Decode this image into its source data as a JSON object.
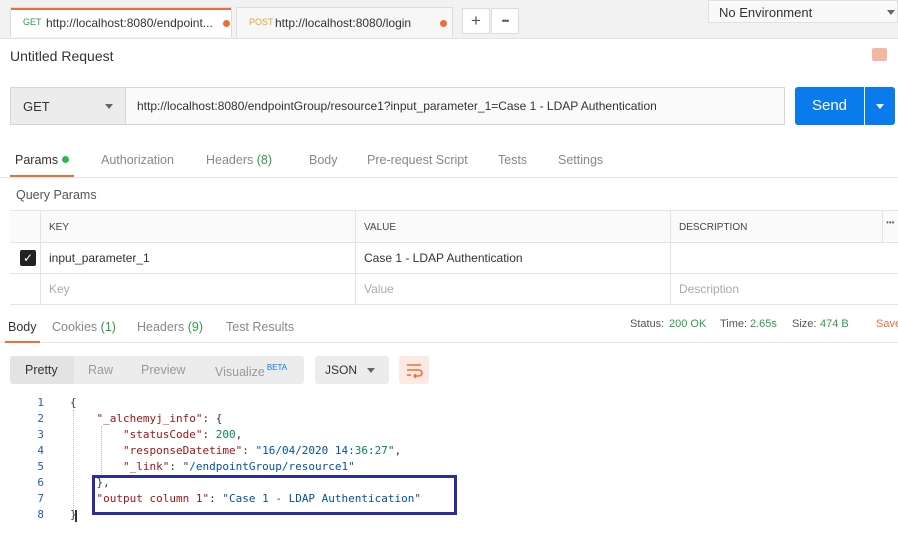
{
  "tabs": [
    {
      "method": "GET",
      "url": "http://localhost:8080/endpoint...",
      "active": true
    },
    {
      "method": "POST",
      "url": "http://localhost:8080/login",
      "active": false
    }
  ],
  "tab_controls": {
    "add": "+",
    "more": "•••"
  },
  "environment": "No Environment",
  "request_title": "Untitled Request",
  "request": {
    "method": "GET",
    "url": "http://localhost:8080/endpointGroup/resource1?input_parameter_1=Case 1 - LDAP Authentication",
    "send_label": "Send"
  },
  "request_tabs": [
    {
      "label": "Params",
      "count": ""
    },
    {
      "label": "Authorization",
      "count": ""
    },
    {
      "label": "Headers",
      "count": "(8)"
    },
    {
      "label": "Body",
      "count": ""
    },
    {
      "label": "Pre-request Script",
      "count": ""
    },
    {
      "label": "Tests",
      "count": ""
    },
    {
      "label": "Settings",
      "count": ""
    }
  ],
  "query_params": {
    "title": "Query Params",
    "headers": [
      "KEY",
      "VALUE",
      "DESCRIPTION"
    ],
    "more": "•••",
    "rows": [
      {
        "checked": true,
        "key": "input_parameter_1",
        "value": "Case 1 - LDAP Authentication",
        "description": ""
      }
    ],
    "placeholders": {
      "key": "Key",
      "value": "Value",
      "description": "Description"
    }
  },
  "response_tabs": [
    {
      "label": "Body",
      "count": ""
    },
    {
      "label": "Cookies",
      "count": "(1)"
    },
    {
      "label": "Headers",
      "count": "(9)"
    },
    {
      "label": "Test Results",
      "count": ""
    }
  ],
  "response_status": {
    "status_label": "Status:",
    "status_value": "200 OK",
    "time_label": "Time:",
    "time_value": "2.65s",
    "size_label": "Size:",
    "size_value": "474 B",
    "save_label": "Save"
  },
  "viewer": {
    "modes": [
      "Pretty",
      "Raw",
      "Preview",
      "Visualize"
    ],
    "beta": "BETA",
    "format": "JSON"
  },
  "code_lines": [
    {
      "n": "1",
      "t": "{"
    },
    {
      "n": "2",
      "t": "    \"_alchemyj_info\": {"
    },
    {
      "n": "3",
      "t": "        \"statusCode\": 200,"
    },
    {
      "n": "4",
      "t": "        \"responseDatetime\": \"16/04/2020 14:36:27\","
    },
    {
      "n": "5",
      "t": "        \"_link\": \"/endpointGroup/resource1\""
    },
    {
      "n": "6",
      "t": "    },"
    },
    {
      "n": "7",
      "t": "    \"output column 1\": \"Case 1 - LDAP Authentication\""
    },
    {
      "n": "8",
      "t": "}"
    }
  ],
  "colors": {
    "accent": "#f26b3a",
    "send": "#097bed",
    "ok": "#2e9c4a",
    "highlight": "#2a2d9c"
  }
}
